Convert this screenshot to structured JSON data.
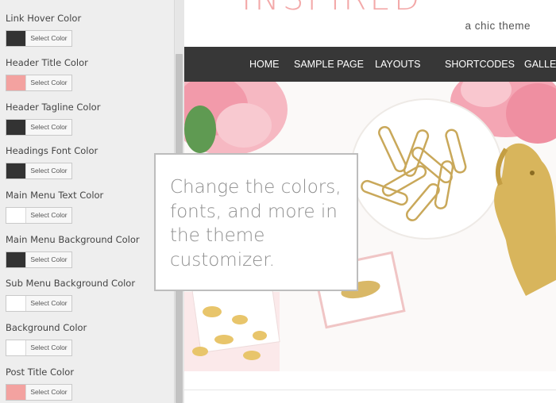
{
  "customizer": {
    "settings": [
      {
        "label": "Link Hover Color",
        "color": "#333333",
        "button": "Select Color"
      },
      {
        "label": "Header Title Color",
        "color": "#f3a2a0",
        "button": "Select Color"
      },
      {
        "label": "Header Tagline Color",
        "color": "#333333",
        "button": "Select Color"
      },
      {
        "label": "Headings Font Color",
        "color": "#333333",
        "button": "Select Color"
      },
      {
        "label": "Main Menu Text Color",
        "color": "#ffffff",
        "button": "Select Color"
      },
      {
        "label": "Main Menu Background Color",
        "color": "#333333",
        "button": "Select Color"
      },
      {
        "label": "Sub Menu Background Color",
        "color": "#ffffff",
        "button": "Select Color"
      },
      {
        "label": "Background Color",
        "color": "#ffffff",
        "button": "Select Color"
      },
      {
        "label": "Post Title Color",
        "color": "#f3a2a0",
        "button": "Select Color"
      }
    ]
  },
  "site": {
    "title": "INSPIRED",
    "tagline": "a chic theme",
    "title_color": "#f3a9a9"
  },
  "nav": {
    "items": [
      "HOME",
      "SAMPLE PAGE",
      "LAYOUTS",
      "SHORTCODES",
      "GALLERY"
    ],
    "background": "#373737"
  },
  "callout": {
    "text": "Change the colors, fonts, and more in the theme customizer."
  }
}
